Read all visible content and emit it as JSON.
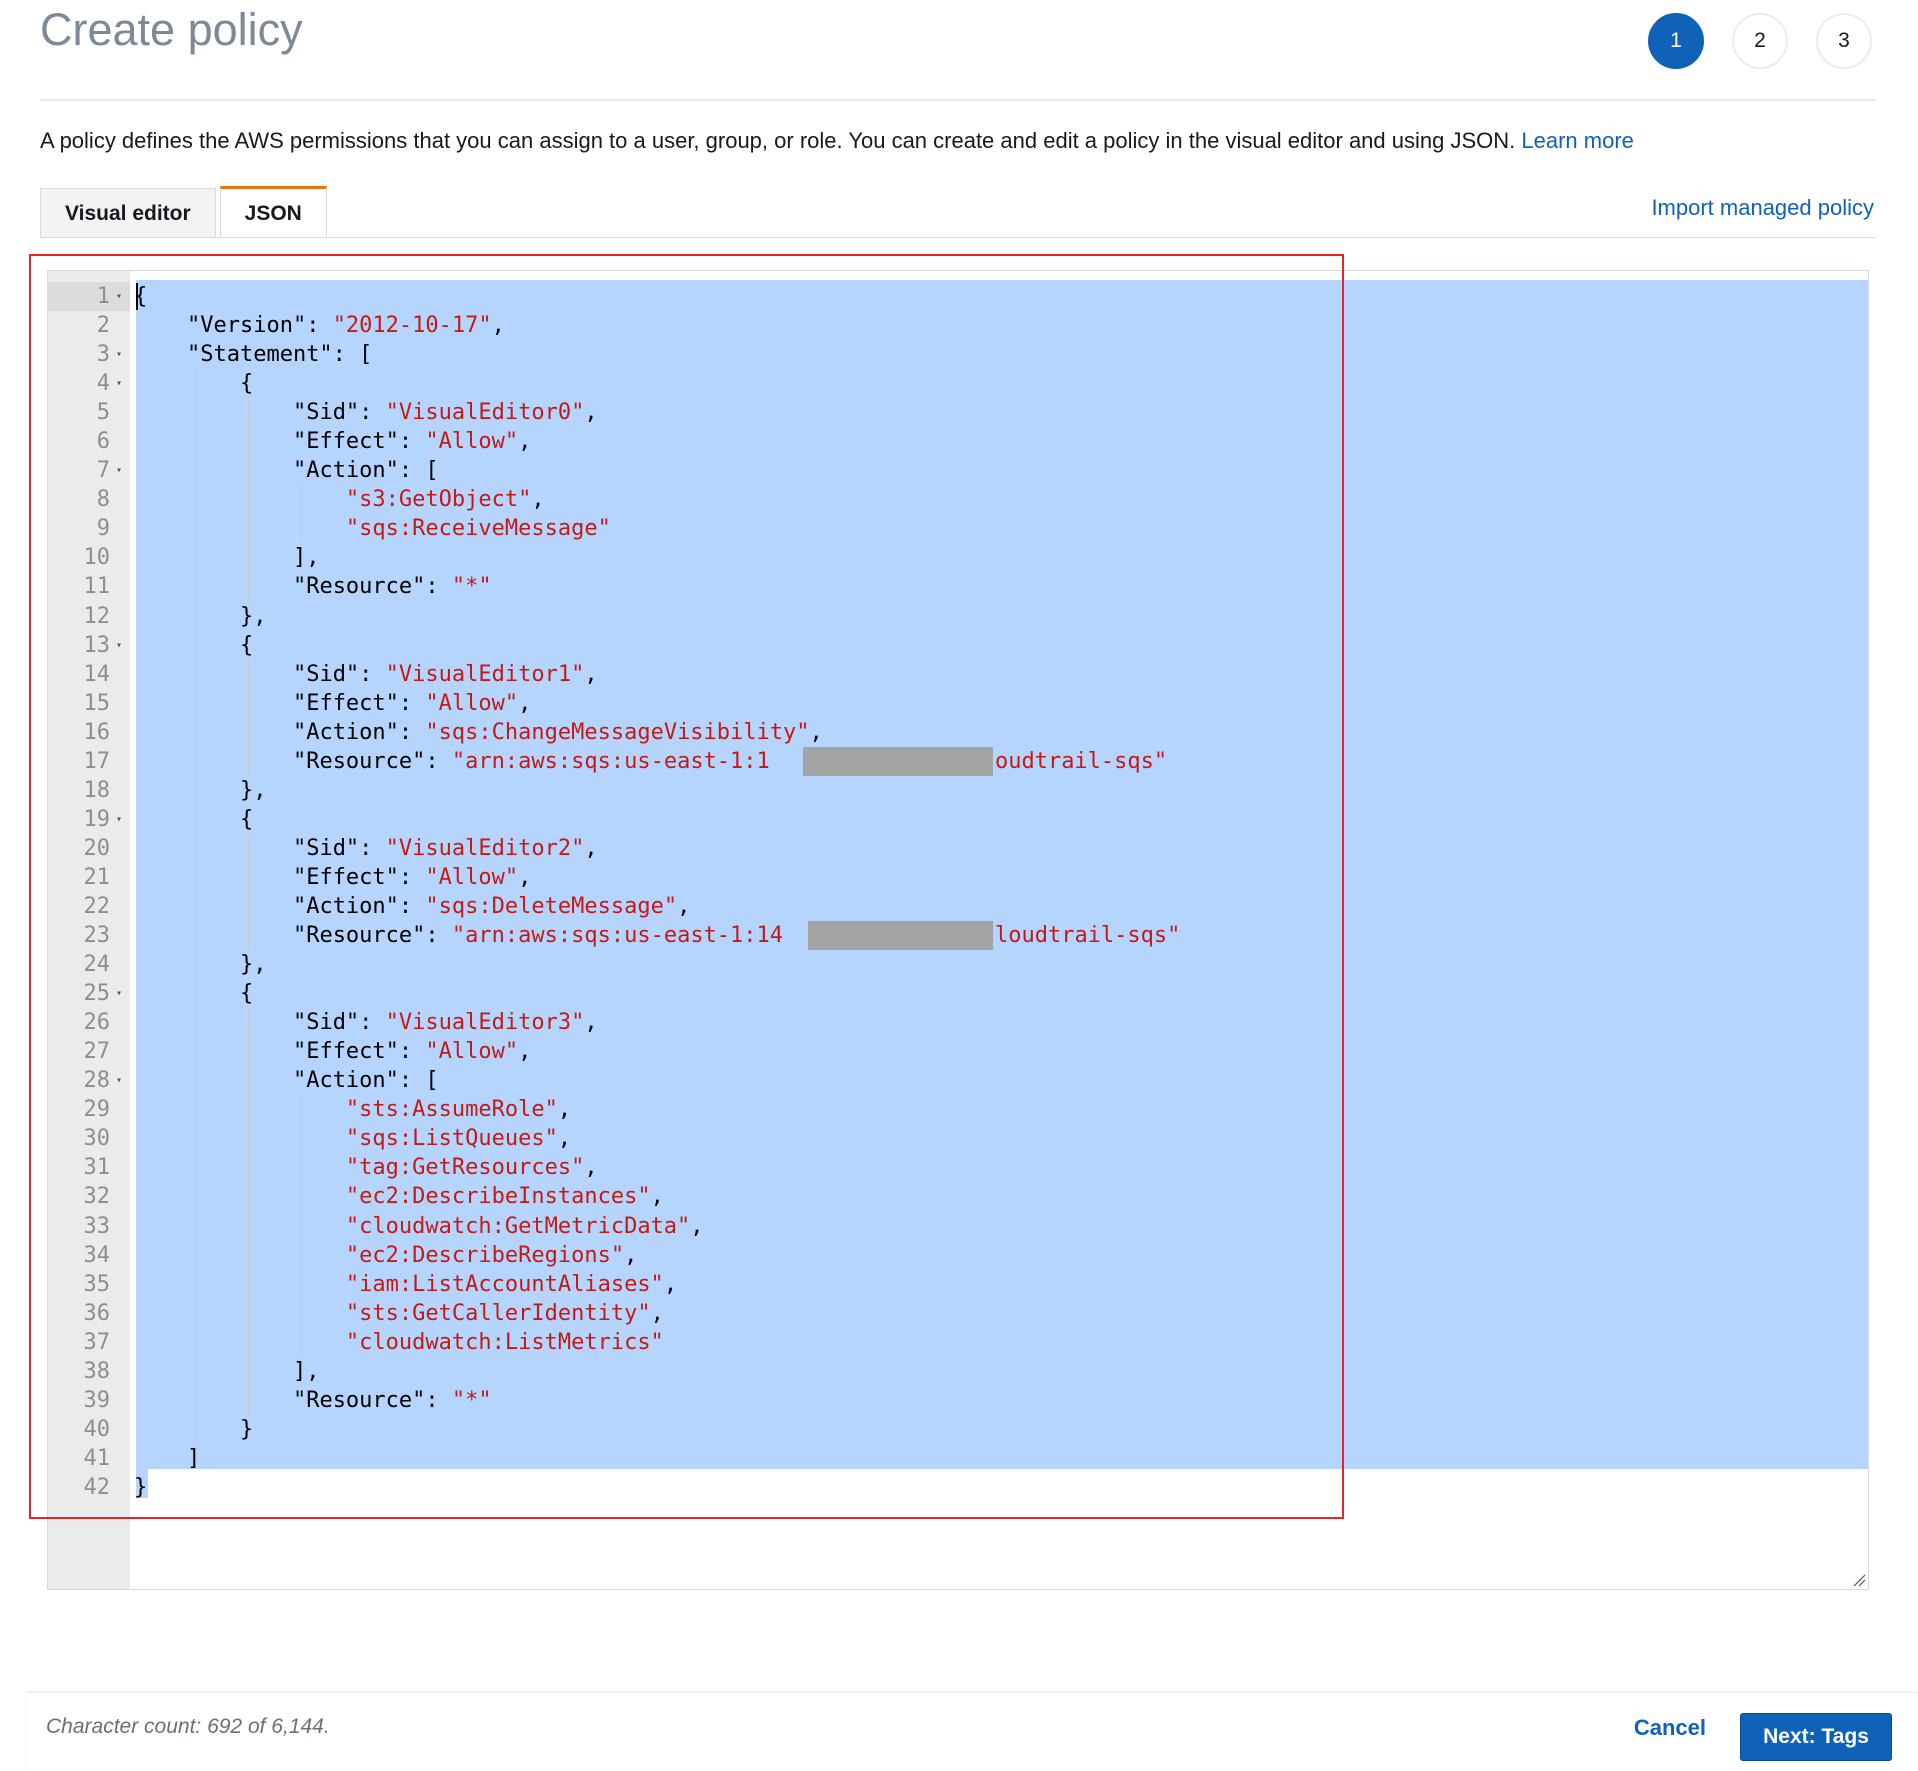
{
  "page": {
    "title": "Create policy",
    "steps": [
      "1",
      "2",
      "3"
    ],
    "description": "A policy defines the AWS permissions that you can assign to a user, group, or role. You can create and edit a policy in the visual editor and using JSON.",
    "learn_more": "Learn more"
  },
  "tabs": [
    {
      "label": "Visual editor",
      "active": false
    },
    {
      "label": "JSON",
      "active": true
    }
  ],
  "import_link": "Import managed policy",
  "editor": {
    "lines": [
      {
        "n": "1",
        "fold": true,
        "indent": 0,
        "parts": [
          [
            "p",
            "{"
          ]
        ]
      },
      {
        "n": "2",
        "fold": false,
        "indent": 1,
        "parts": [
          [
            "p",
            "\"Version\": "
          ],
          [
            "s",
            "\"2012-10-17\""
          ],
          [
            "p",
            ","
          ]
        ]
      },
      {
        "n": "3",
        "fold": true,
        "indent": 1,
        "parts": [
          [
            "p",
            "\"Statement\": ["
          ]
        ]
      },
      {
        "n": "4",
        "fold": true,
        "indent": 2,
        "parts": [
          [
            "p",
            "{"
          ]
        ]
      },
      {
        "n": "5",
        "fold": false,
        "indent": 3,
        "parts": [
          [
            "p",
            "\"Sid\": "
          ],
          [
            "s",
            "\"VisualEditor0\""
          ],
          [
            "p",
            ","
          ]
        ]
      },
      {
        "n": "6",
        "fold": false,
        "indent": 3,
        "parts": [
          [
            "p",
            "\"Effect\": "
          ],
          [
            "s",
            "\"Allow\""
          ],
          [
            "p",
            ","
          ]
        ]
      },
      {
        "n": "7",
        "fold": true,
        "indent": 3,
        "parts": [
          [
            "p",
            "\"Action\": ["
          ]
        ]
      },
      {
        "n": "8",
        "fold": false,
        "indent": 4,
        "parts": [
          [
            "s",
            "\"s3:GetObject\""
          ],
          [
            "p",
            ","
          ]
        ]
      },
      {
        "n": "9",
        "fold": false,
        "indent": 4,
        "parts": [
          [
            "s",
            "\"sqs:ReceiveMessage\""
          ]
        ]
      },
      {
        "n": "10",
        "fold": false,
        "indent": 3,
        "parts": [
          [
            "p",
            "],"
          ]
        ]
      },
      {
        "n": "11",
        "fold": false,
        "indent": 3,
        "parts": [
          [
            "p",
            "\"Resource\": "
          ],
          [
            "s",
            "\"*\""
          ]
        ]
      },
      {
        "n": "12",
        "fold": false,
        "indent": 2,
        "parts": [
          [
            "p",
            "},"
          ]
        ]
      },
      {
        "n": "13",
        "fold": true,
        "indent": 2,
        "parts": [
          [
            "p",
            "{"
          ]
        ]
      },
      {
        "n": "14",
        "fold": false,
        "indent": 3,
        "parts": [
          [
            "p",
            "\"Sid\": "
          ],
          [
            "s",
            "\"VisualEditor1\""
          ],
          [
            "p",
            ","
          ]
        ]
      },
      {
        "n": "15",
        "fold": false,
        "indent": 3,
        "parts": [
          [
            "p",
            "\"Effect\": "
          ],
          [
            "s",
            "\"Allow\""
          ],
          [
            "p",
            ","
          ]
        ]
      },
      {
        "n": "16",
        "fold": false,
        "indent": 3,
        "parts": [
          [
            "p",
            "\"Action\": "
          ],
          [
            "s",
            "\"sqs:ChangeMessageVisibility\""
          ],
          [
            "p",
            ","
          ]
        ]
      },
      {
        "n": "17",
        "fold": false,
        "indent": 3,
        "parts": [
          [
            "p",
            "\"Resource\": "
          ],
          [
            "s",
            "\"arn:aws:sqs:us-east-1:1"
          ],
          [
            "s",
            "             "
          ],
          [
            "s",
            "s-cloudtrail-sqs\""
          ]
        ]
      },
      {
        "n": "18",
        "fold": false,
        "indent": 2,
        "parts": [
          [
            "p",
            "},"
          ]
        ]
      },
      {
        "n": "19",
        "fold": true,
        "indent": 2,
        "parts": [
          [
            "p",
            "{"
          ]
        ]
      },
      {
        "n": "20",
        "fold": false,
        "indent": 3,
        "parts": [
          [
            "p",
            "\"Sid\": "
          ],
          [
            "s",
            "\"VisualEditor2\""
          ],
          [
            "p",
            ","
          ]
        ]
      },
      {
        "n": "21",
        "fold": false,
        "indent": 3,
        "parts": [
          [
            "p",
            "\"Effect\": "
          ],
          [
            "s",
            "\"Allow\""
          ],
          [
            "p",
            ","
          ]
        ]
      },
      {
        "n": "22",
        "fold": false,
        "indent": 3,
        "parts": [
          [
            "p",
            "\"Action\": "
          ],
          [
            "s",
            "\"sqs:DeleteMessage\""
          ],
          [
            "p",
            ","
          ]
        ]
      },
      {
        "n": "23",
        "fold": false,
        "indent": 3,
        "parts": [
          [
            "p",
            "\"Resource\": "
          ],
          [
            "s",
            "\"arn:aws:sqs:us-east-1:14"
          ],
          [
            "s",
            "             "
          ],
          [
            "s",
            "s-cloudtrail-sqs\""
          ]
        ]
      },
      {
        "n": "24",
        "fold": false,
        "indent": 2,
        "parts": [
          [
            "p",
            "},"
          ]
        ]
      },
      {
        "n": "25",
        "fold": true,
        "indent": 2,
        "parts": [
          [
            "p",
            "{"
          ]
        ]
      },
      {
        "n": "26",
        "fold": false,
        "indent": 3,
        "parts": [
          [
            "p",
            "\"Sid\": "
          ],
          [
            "s",
            "\"VisualEditor3\""
          ],
          [
            "p",
            ","
          ]
        ]
      },
      {
        "n": "27",
        "fold": false,
        "indent": 3,
        "parts": [
          [
            "p",
            "\"Effect\": "
          ],
          [
            "s",
            "\"Allow\""
          ],
          [
            "p",
            ","
          ]
        ]
      },
      {
        "n": "28",
        "fold": true,
        "indent": 3,
        "parts": [
          [
            "p",
            "\"Action\": ["
          ]
        ]
      },
      {
        "n": "29",
        "fold": false,
        "indent": 4,
        "parts": [
          [
            "s",
            "\"sts:AssumeRole\""
          ],
          [
            "p",
            ","
          ]
        ]
      },
      {
        "n": "30",
        "fold": false,
        "indent": 4,
        "parts": [
          [
            "s",
            "\"sqs:ListQueues\""
          ],
          [
            "p",
            ","
          ]
        ]
      },
      {
        "n": "31",
        "fold": false,
        "indent": 4,
        "parts": [
          [
            "s",
            "\"tag:GetResources\""
          ],
          [
            "p",
            ","
          ]
        ]
      },
      {
        "n": "32",
        "fold": false,
        "indent": 4,
        "parts": [
          [
            "s",
            "\"ec2:DescribeInstances\""
          ],
          [
            "p",
            ","
          ]
        ]
      },
      {
        "n": "33",
        "fold": false,
        "indent": 4,
        "parts": [
          [
            "s",
            "\"cloudwatch:GetMetricData\""
          ],
          [
            "p",
            ","
          ]
        ]
      },
      {
        "n": "34",
        "fold": false,
        "indent": 4,
        "parts": [
          [
            "s",
            "\"ec2:DescribeRegions\""
          ],
          [
            "p",
            ","
          ]
        ]
      },
      {
        "n": "35",
        "fold": false,
        "indent": 4,
        "parts": [
          [
            "s",
            "\"iam:ListAccountAliases\""
          ],
          [
            "p",
            ","
          ]
        ]
      },
      {
        "n": "36",
        "fold": false,
        "indent": 4,
        "parts": [
          [
            "s",
            "\"sts:GetCallerIdentity\""
          ],
          [
            "p",
            ","
          ]
        ]
      },
      {
        "n": "37",
        "fold": false,
        "indent": 4,
        "parts": [
          [
            "s",
            "\"cloudwatch:ListMetrics\""
          ]
        ]
      },
      {
        "n": "38",
        "fold": false,
        "indent": 3,
        "parts": [
          [
            "p",
            "],"
          ]
        ]
      },
      {
        "n": "39",
        "fold": false,
        "indent": 3,
        "parts": [
          [
            "p",
            "\"Resource\": "
          ],
          [
            "s",
            "\"*\""
          ]
        ]
      },
      {
        "n": "40",
        "fold": false,
        "indent": 2,
        "parts": [
          [
            "p",
            "}"
          ]
        ]
      },
      {
        "n": "41",
        "fold": false,
        "indent": 1,
        "parts": [
          [
            "p",
            "]"
          ]
        ]
      },
      {
        "n": "42",
        "fold": false,
        "indent": 0,
        "parts": [
          [
            "p",
            "}"
          ]
        ]
      }
    ]
  },
  "footer": {
    "character_count": "Character count: 692 of 6,144.",
    "cancel": "Cancel",
    "next": "Next: Tags"
  }
}
